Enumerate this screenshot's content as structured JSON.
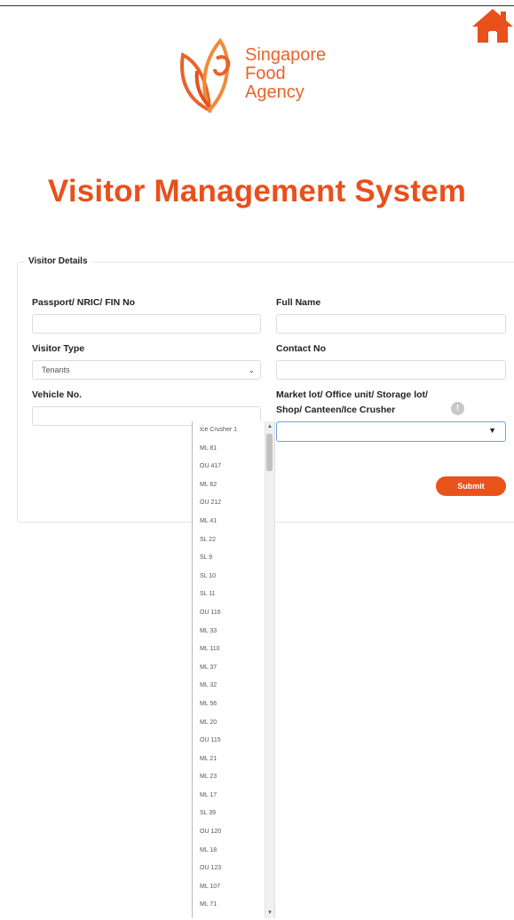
{
  "brand": {
    "logo_line1": "Singapore",
    "logo_line2": "Food",
    "logo_line3": "Agency",
    "color": "#e8632c"
  },
  "header": {
    "title": "Visitor Management System",
    "home_icon": "home-icon",
    "home_color": "#e8501c"
  },
  "form": {
    "legend": "Visitor Details",
    "passport_label": "Passport/ NRIC/ FIN No",
    "passport_value": "",
    "full_name_label": "Full Name",
    "full_name_value": "",
    "visitor_type_label": "Visitor Type",
    "visitor_type_value": "Tenants",
    "contact_label": "Contact No",
    "contact_value": "",
    "vehicle_label": "Vehicle No.",
    "vehicle_value": "",
    "unit_label_line1": "Market lot/ Office unit/ Storage lot/",
    "unit_label_line2": "Shop/ Canteen/Ice Crusher",
    "unit_value": "",
    "info_icon": "info-icon",
    "submit_label": "Submit",
    "submit_color": "#e8531c"
  },
  "dropdown": {
    "options": [
      "Ice Crusher 1",
      "ML 81",
      "OU 417",
      "ML 62",
      "OU 212",
      "ML 41",
      "SL 22",
      "SL 9",
      "SL 10",
      "SL 11",
      "OU 116",
      "ML 33",
      "ML 110",
      "ML 37",
      "ML 32",
      "ML 56",
      "ML 20",
      "OU 115",
      "ML 21",
      "ML 23",
      "ML 17",
      "SL 39",
      "OU 120",
      "ML 18",
      "OU 123",
      "ML 107",
      "ML 71"
    ]
  }
}
